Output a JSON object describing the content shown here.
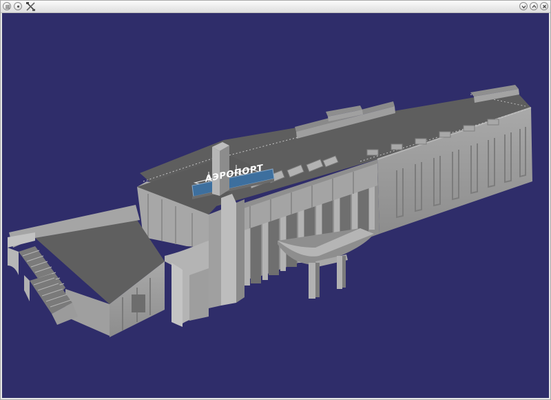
{
  "window": {
    "title": "",
    "controls": [
      "window-menu",
      "minimize",
      "maximize",
      "close"
    ],
    "app_icon": "tools-icon"
  },
  "scene": {
    "background": "#2f2d6a",
    "building_color": "#9a9a9a",
    "sign": {
      "text": "АЭРОПОРТ",
      "background": "#3d6f9e",
      "text_color": "#ffffff"
    }
  }
}
